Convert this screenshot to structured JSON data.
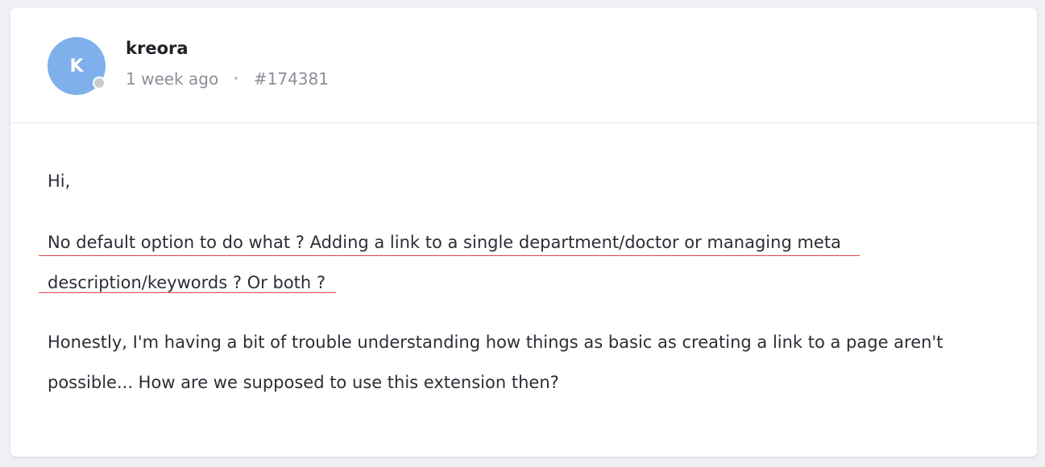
{
  "post": {
    "author": "kreora",
    "avatar_initial": "K",
    "time": "1 week ago",
    "separator": "•",
    "post_id": "#174381"
  },
  "content": {
    "greeting": "Hi,",
    "highlighted_line_1": "No default option to do what ? Adding a link to a single department/doctor or managing meta",
    "highlighted_line_2": "description/keywords ? Or both ?",
    "paragraph_line_1": "Honestly, I'm having a bit of trouble understanding how things as basic as creating a link to a page aren't",
    "paragraph_line_2": "possible... How are we supposed to use this extension then?"
  },
  "colors": {
    "avatar_bg": "#7fb0eb",
    "status_dot": "#c9cbcf",
    "annotation_underline": "#e0484e",
    "page_bg": "#eef0f4"
  }
}
